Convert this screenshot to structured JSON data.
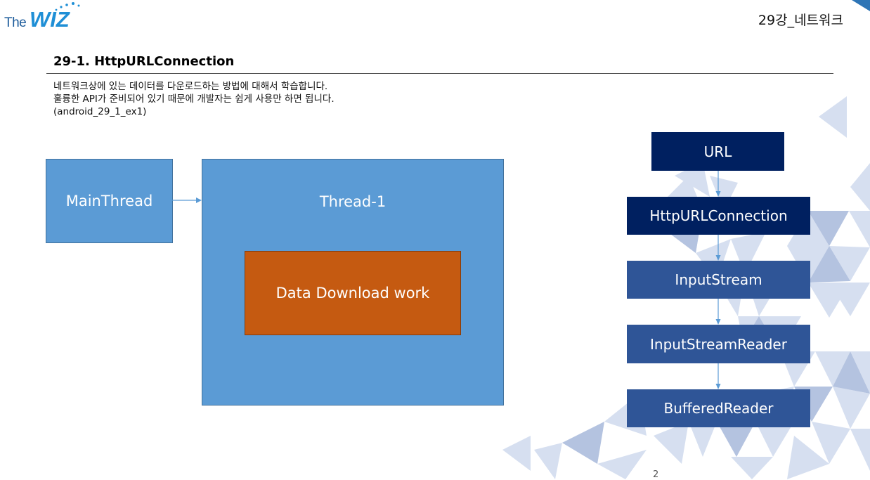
{
  "header": {
    "logo_the": "The",
    "logo_wiz": "WIZ",
    "chapter": "29강_네트워크"
  },
  "section": {
    "title": "29-1. HttpURLConnection",
    "description": [
      "네트워크상에 있는 데이터를 다운로드하는 방법에 대해서 학습합니다.",
      "훌륭한 API가 준비되어 있기 때문에 개발자는 쉽게 사용만 하면 됩니다.",
      "(android_29_1_ex1)"
    ]
  },
  "thread_diagram": {
    "main_thread": "MainThread",
    "worker_thread": "Thread-1",
    "work": "Data Download work"
  },
  "flow_diagram": {
    "steps": [
      "URL",
      "HttpURLConnection",
      "InputStream",
      "InputStreamReader",
      "BufferedReader"
    ]
  },
  "colors": {
    "thread_blue": "#5b9bd5",
    "work_orange": "#c55a11",
    "flow_dark": "#002060",
    "flow_mid": "#2f5597"
  },
  "footer": {
    "page_number": "2"
  }
}
